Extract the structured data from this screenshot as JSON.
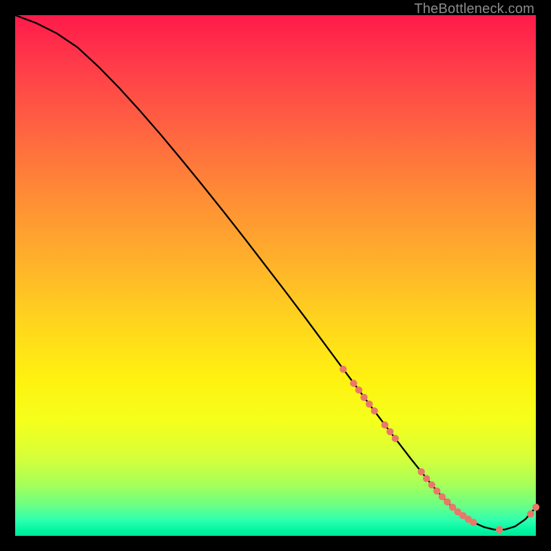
{
  "watermark": "TheBottleneck.com",
  "colors": {
    "page_bg": "#000000",
    "curve_stroke": "#000000",
    "marker_fill": "#e9786a",
    "marker_stroke": "#c85a4e",
    "watermark_text": "#8c8c8c"
  },
  "chart_data": {
    "type": "line",
    "title": "",
    "xlabel": "",
    "ylabel": "",
    "xlim": [
      0,
      100
    ],
    "ylim": [
      0,
      100
    ],
    "grid": false,
    "legend": false,
    "x": [
      0,
      4,
      8,
      12,
      16,
      20,
      24,
      28,
      32,
      36,
      40,
      44,
      48,
      52,
      56,
      60,
      64,
      68,
      72,
      76,
      80,
      82,
      84,
      86,
      88,
      90,
      92,
      94,
      96,
      98,
      100
    ],
    "y": [
      100,
      98.5,
      96.5,
      93.8,
      90.1,
      86.0,
      81.6,
      77.0,
      72.2,
      67.3,
      62.3,
      57.2,
      52.0,
      46.8,
      41.5,
      36.1,
      30.7,
      25.3,
      20.0,
      14.8,
      9.8,
      7.5,
      5.5,
      3.9,
      2.6,
      1.7,
      1.2,
      1.2,
      1.8,
      3.2,
      5.5
    ],
    "markers_visible": {
      "x": [
        63,
        65,
        66,
        67,
        68,
        69,
        71,
        72,
        73,
        78,
        79,
        80,
        81,
        82,
        83,
        84,
        85,
        86,
        87,
        88,
        93,
        99,
        100
      ],
      "y": [
        32.0,
        29.3,
        28.0,
        26.6,
        25.3,
        24.0,
        21.3,
        20.0,
        18.7,
        12.3,
        11.0,
        9.8,
        8.6,
        7.5,
        6.5,
        5.5,
        4.6,
        3.9,
        3.2,
        2.6,
        1.2,
        4.2,
        5.5
      ]
    }
  }
}
